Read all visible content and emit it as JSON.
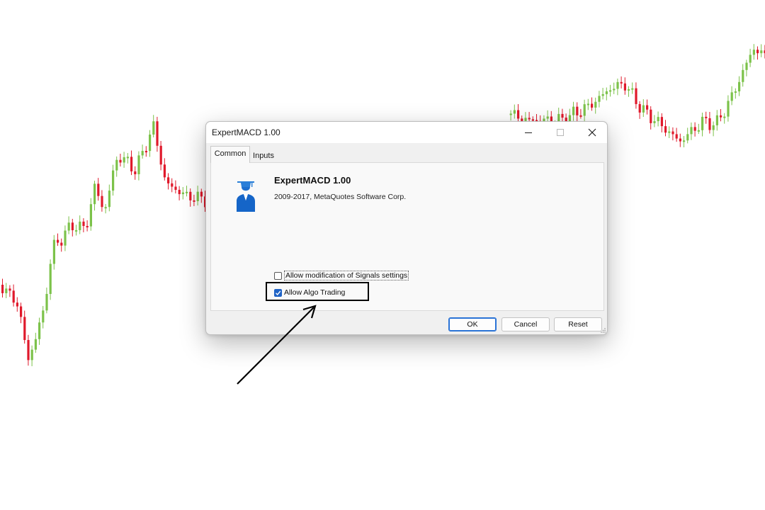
{
  "colors": {
    "up_candle": "#7cc24a",
    "down_candle": "#e0192b",
    "accent": "#1f63c6"
  },
  "dialog": {
    "title": "ExpertMACD 1.00",
    "controls": [
      "minimize",
      "maximize",
      "close"
    ],
    "tabs": [
      {
        "label": "Common",
        "active": true
      },
      {
        "label": "Inputs",
        "active": false
      }
    ],
    "app": {
      "icon": "graduate-icon",
      "name": "ExpertMACD 1.00",
      "copyright": "2009-2017, MetaQuotes Software Corp."
    },
    "options": {
      "signals": {
        "label": "Allow modification of Signals settings",
        "checked": false
      },
      "algo": {
        "label": "Allow Algo Trading",
        "checked": true
      }
    },
    "buttons": {
      "ok": "OK",
      "cancel": "Cancel",
      "reset": "Reset"
    }
  }
}
